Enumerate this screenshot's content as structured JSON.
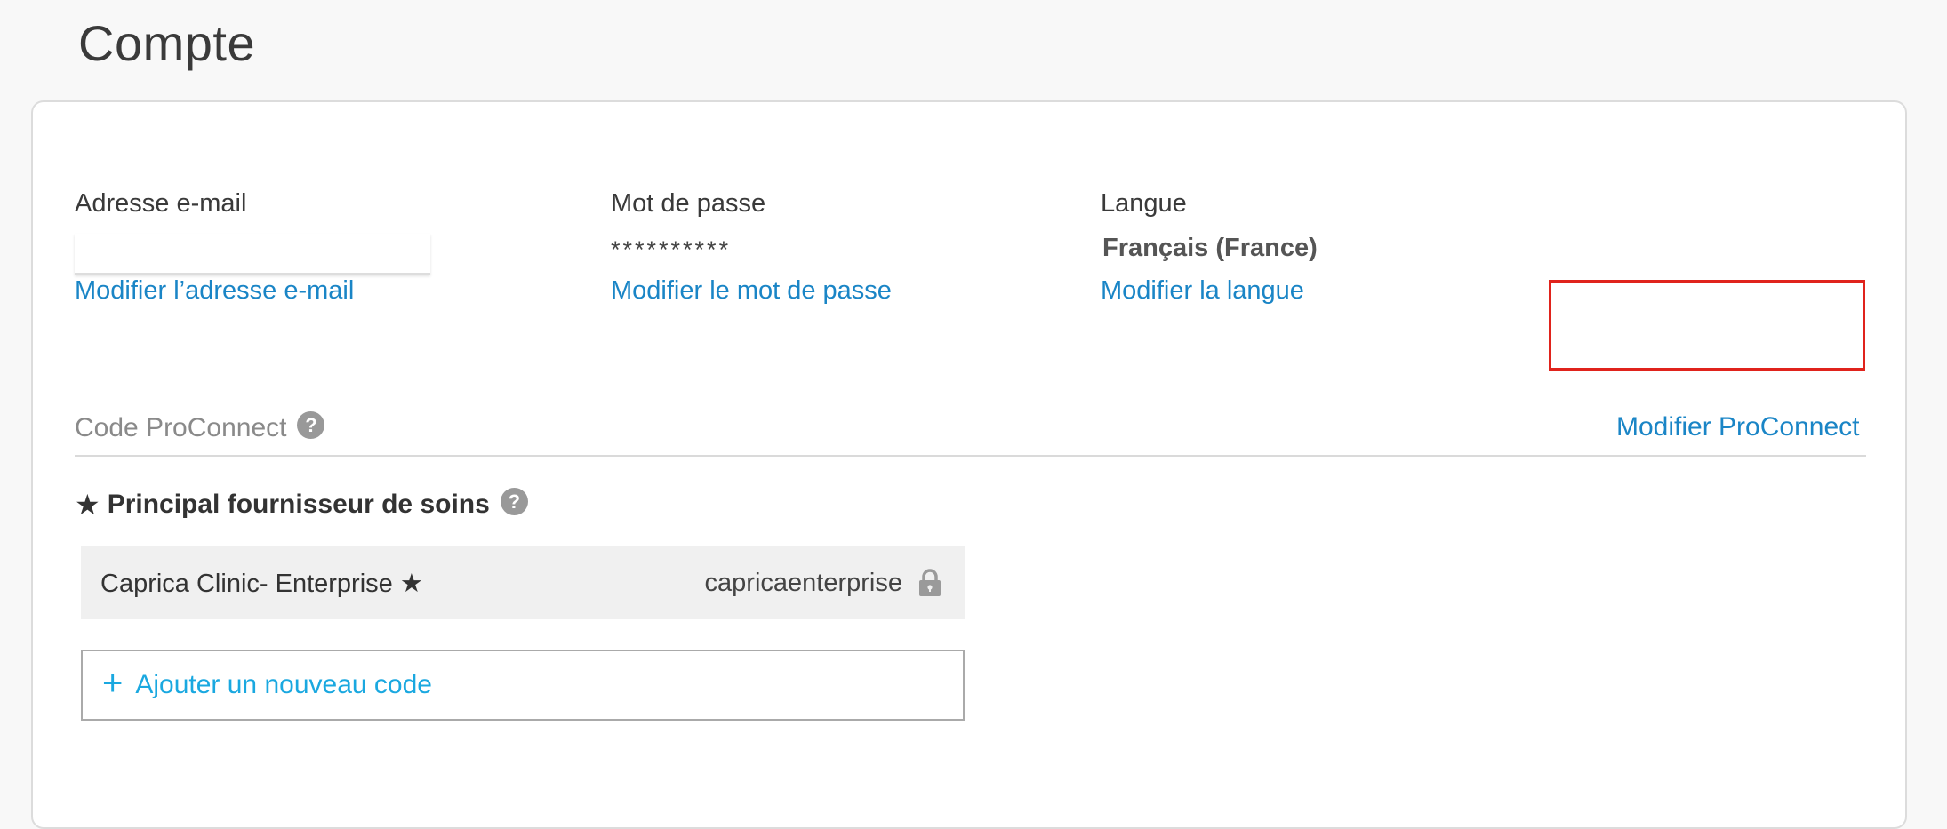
{
  "page": {
    "title": "Compte"
  },
  "account": {
    "email": {
      "label": "Adresse e-mail",
      "value": "",
      "change_link": "Modifier l’adresse e-mail"
    },
    "password": {
      "label": "Mot de passe",
      "value": "**********",
      "change_link": "Modifier le mot de passe"
    },
    "language": {
      "label": "Langue",
      "value": "Français (France)",
      "change_link": "Modifier la langue"
    }
  },
  "proconnect": {
    "section_label": "Code ProConnect",
    "help_icon": "?",
    "change_link": "Modifier ProConnect",
    "highlight_color": "#e0231c"
  },
  "primary_provider": {
    "star": "★",
    "heading": "Principal fournisseur de soins",
    "help_icon": "?",
    "codes": [
      {
        "name": "Caprica Clinic- Enterprise ★",
        "code": "capricaenterprise",
        "icon": "lock-icon"
      }
    ]
  },
  "add_code": {
    "icon": "+",
    "label": "Ajouter un nouveau code"
  },
  "colors": {
    "link": "#1a85c6",
    "add_link": "#1aa8e0",
    "background": "#f8f8f8",
    "card": "#ffffff"
  }
}
